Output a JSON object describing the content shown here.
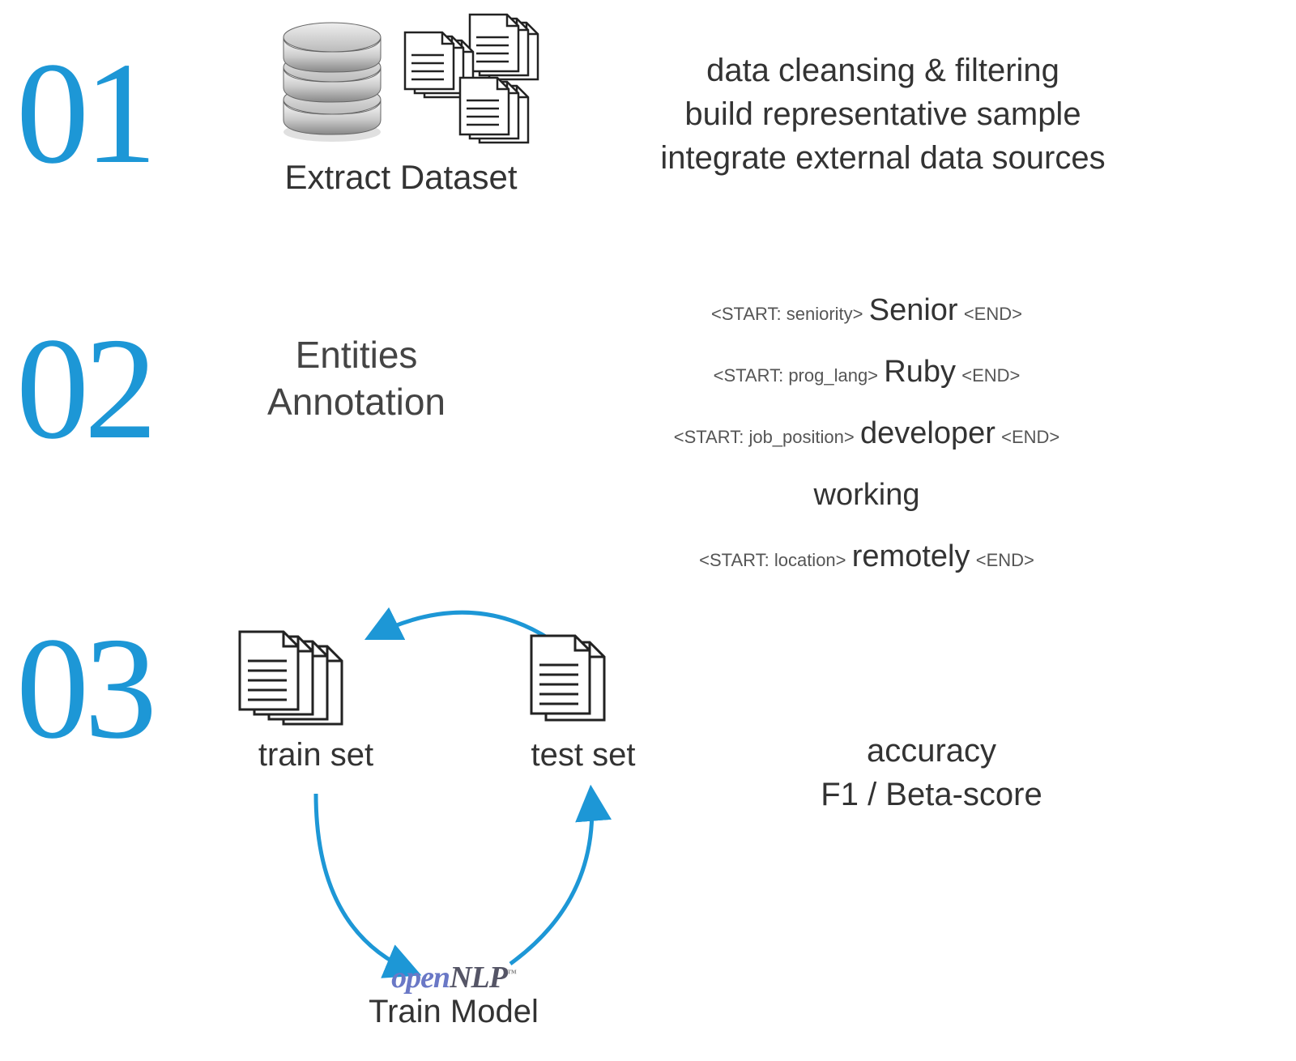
{
  "steps": {
    "s1": {
      "num": "01",
      "title_light": "Extract ",
      "title_reg": "Dataset",
      "desc1": "data cleansing & filtering",
      "desc2": "build representative sample",
      "desc3": "integrate external data sources"
    },
    "s2": {
      "num": "02",
      "title_line1": "Entities",
      "title_line2_a": "A",
      "title_line2_b": "nnotation",
      "a1_tag": "<START: seniority>",
      "a1_val": "Senior",
      "a1_end": "<END>",
      "a2_tag": "<START: prog_lang>",
      "a2_val": "Ruby",
      "a2_end": "<END>",
      "a3_tag": "<START: job_position>",
      "a3_val": "developer",
      "a3_end": "<END>",
      "a4_val": "working",
      "a5_tag": "<START: location>",
      "a5_val": "remotely",
      "a5_end": "<END>"
    },
    "s3": {
      "num": "03",
      "train_a": "train",
      "train_b": " set",
      "test_a": "test",
      "test_b": " set",
      "logo_a": "open",
      "logo_b": "NLP",
      "logo_tm": "™",
      "train_model_a": "Train ",
      "train_model_b": "Model",
      "metric1": "accuracy",
      "metric2": "F1 / Beta-score"
    }
  }
}
